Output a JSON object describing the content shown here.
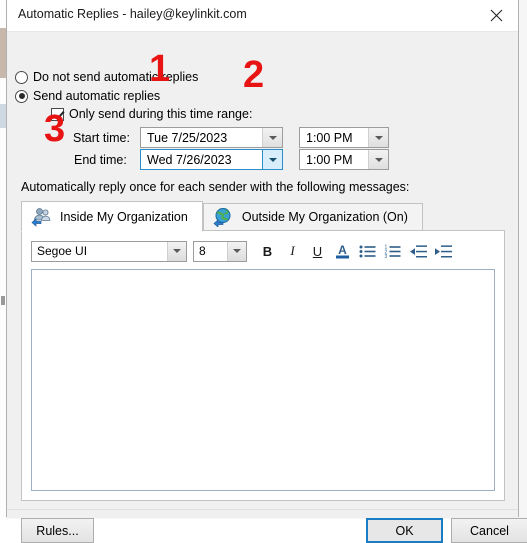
{
  "window": {
    "title": "Automatic Replies - hailey@keylinkit.com",
    "close_icon": "close-icon"
  },
  "options": {
    "do_not_send_label": "Do not send automatic replies",
    "do_not_send_selected": false,
    "send_replies_label": "Send automatic replies",
    "send_replies_selected": true,
    "time_range_label": "Only send during this time range:",
    "time_range_checked": true
  },
  "schedule": {
    "start_label": "Start time:",
    "start_date": "Tue 7/25/2023",
    "start_time": "1:00 PM",
    "end_label": "End time:",
    "end_date": "Wed 7/26/2023",
    "end_time": "1:00 PM"
  },
  "note": "Automatically reply once for each sender with the following messages:",
  "tabs": [
    {
      "label": "Inside My Organization",
      "icon": "people-icon",
      "active": true
    },
    {
      "label": "Outside My Organization (On)",
      "icon": "globe-icon",
      "active": false
    }
  ],
  "editor": {
    "font_family": "Segoe UI",
    "font_size": "8",
    "bold_label": "B",
    "italic_label": "I",
    "underline_label": "U",
    "font_color_label": "A",
    "bullet_list_icon": "bullet-list-icon",
    "numbered_list_icon": "numbered-list-icon",
    "decrease_indent_icon": "decrease-indent-icon",
    "increase_indent_icon": "increase-indent-icon",
    "message_body": ""
  },
  "footer": {
    "rules_label": "Rules...",
    "ok_label": "OK",
    "cancel_label": "Cancel"
  },
  "annotations": [
    {
      "text": "1"
    },
    {
      "text": "2"
    },
    {
      "text": "3"
    }
  ],
  "colors": {
    "accent": "#1a7cc4",
    "annotation_red": "#e81313",
    "toolbar_icon": "#2e5f8a"
  }
}
